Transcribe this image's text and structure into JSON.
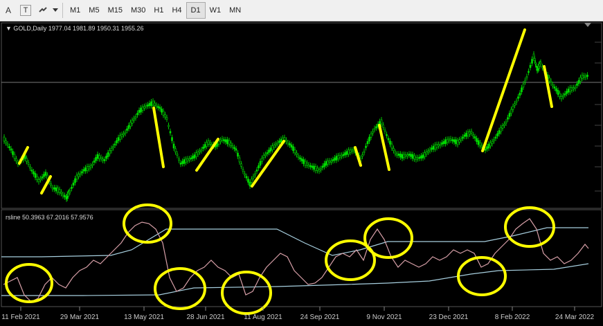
{
  "toolbar": {
    "icons": [
      "text-a-icon",
      "text-t-icon",
      "shapes-icon",
      "dropdown-arrow-icon"
    ],
    "a_glyph": "A",
    "t_glyph": "T",
    "timeframes": [
      "M1",
      "M5",
      "M15",
      "M30",
      "H1",
      "H4",
      "D1",
      "W1",
      "MN"
    ],
    "active_timeframe": "D1"
  },
  "price_panel": {
    "header": "GOLD,Daily  1977.04 1981.89 1950.31 1955.26",
    "bull_color": "#00e000",
    "bear_color": "#00c000"
  },
  "indicator_panel": {
    "header": "rsline 50.3963 67.2016 57.9576",
    "rsi_color": "#d8a0a8",
    "band_color": "#a8d0e0"
  },
  "x_axis": {
    "labels": [
      "11 Feb 2021",
      "29 Mar 2021",
      "13 May 2021",
      "28 Jun 2021",
      "11 Aug 2021",
      "24 Sep 2021",
      "9 Nov 2021",
      "23 Dec 2021",
      "8 Feb 2022",
      "24 Mar 2022"
    ]
  },
  "annotations": {
    "color": "#ffff00"
  }
}
